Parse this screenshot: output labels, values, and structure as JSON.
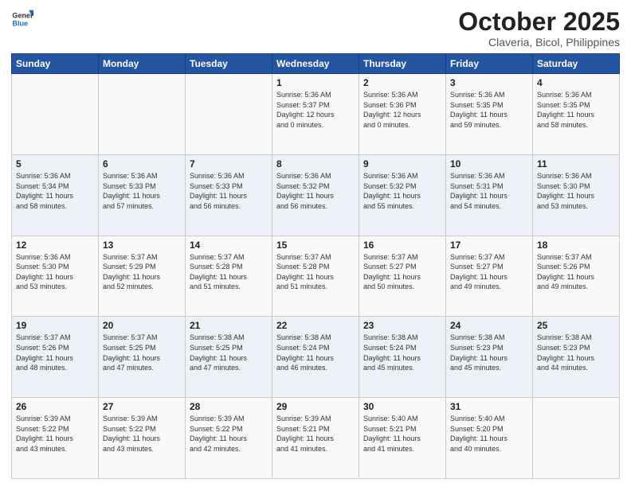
{
  "header": {
    "logo_general": "General",
    "logo_blue": "Blue",
    "month_title": "October 2025",
    "subtitle": "Claveria, Bicol, Philippines"
  },
  "weekdays": [
    "Sunday",
    "Monday",
    "Tuesday",
    "Wednesday",
    "Thursday",
    "Friday",
    "Saturday"
  ],
  "weeks": [
    [
      {
        "day": "",
        "info": ""
      },
      {
        "day": "",
        "info": ""
      },
      {
        "day": "",
        "info": ""
      },
      {
        "day": "1",
        "info": "Sunrise: 5:36 AM\nSunset: 5:37 PM\nDaylight: 12 hours\nand 0 minutes."
      },
      {
        "day": "2",
        "info": "Sunrise: 5:36 AM\nSunset: 5:36 PM\nDaylight: 12 hours\nand 0 minutes."
      },
      {
        "day": "3",
        "info": "Sunrise: 5:36 AM\nSunset: 5:35 PM\nDaylight: 11 hours\nand 59 minutes."
      },
      {
        "day": "4",
        "info": "Sunrise: 5:36 AM\nSunset: 5:35 PM\nDaylight: 11 hours\nand 58 minutes."
      }
    ],
    [
      {
        "day": "5",
        "info": "Sunrise: 5:36 AM\nSunset: 5:34 PM\nDaylight: 11 hours\nand 58 minutes."
      },
      {
        "day": "6",
        "info": "Sunrise: 5:36 AM\nSunset: 5:33 PM\nDaylight: 11 hours\nand 57 minutes."
      },
      {
        "day": "7",
        "info": "Sunrise: 5:36 AM\nSunset: 5:33 PM\nDaylight: 11 hours\nand 56 minutes."
      },
      {
        "day": "8",
        "info": "Sunrise: 5:36 AM\nSunset: 5:32 PM\nDaylight: 11 hours\nand 56 minutes."
      },
      {
        "day": "9",
        "info": "Sunrise: 5:36 AM\nSunset: 5:32 PM\nDaylight: 11 hours\nand 55 minutes."
      },
      {
        "day": "10",
        "info": "Sunrise: 5:36 AM\nSunset: 5:31 PM\nDaylight: 11 hours\nand 54 minutes."
      },
      {
        "day": "11",
        "info": "Sunrise: 5:36 AM\nSunset: 5:30 PM\nDaylight: 11 hours\nand 53 minutes."
      }
    ],
    [
      {
        "day": "12",
        "info": "Sunrise: 5:36 AM\nSunset: 5:30 PM\nDaylight: 11 hours\nand 53 minutes."
      },
      {
        "day": "13",
        "info": "Sunrise: 5:37 AM\nSunset: 5:29 PM\nDaylight: 11 hours\nand 52 minutes."
      },
      {
        "day": "14",
        "info": "Sunrise: 5:37 AM\nSunset: 5:28 PM\nDaylight: 11 hours\nand 51 minutes."
      },
      {
        "day": "15",
        "info": "Sunrise: 5:37 AM\nSunset: 5:28 PM\nDaylight: 11 hours\nand 51 minutes."
      },
      {
        "day": "16",
        "info": "Sunrise: 5:37 AM\nSunset: 5:27 PM\nDaylight: 11 hours\nand 50 minutes."
      },
      {
        "day": "17",
        "info": "Sunrise: 5:37 AM\nSunset: 5:27 PM\nDaylight: 11 hours\nand 49 minutes."
      },
      {
        "day": "18",
        "info": "Sunrise: 5:37 AM\nSunset: 5:26 PM\nDaylight: 11 hours\nand 49 minutes."
      }
    ],
    [
      {
        "day": "19",
        "info": "Sunrise: 5:37 AM\nSunset: 5:26 PM\nDaylight: 11 hours\nand 48 minutes."
      },
      {
        "day": "20",
        "info": "Sunrise: 5:37 AM\nSunset: 5:25 PM\nDaylight: 11 hours\nand 47 minutes."
      },
      {
        "day": "21",
        "info": "Sunrise: 5:38 AM\nSunset: 5:25 PM\nDaylight: 11 hours\nand 47 minutes."
      },
      {
        "day": "22",
        "info": "Sunrise: 5:38 AM\nSunset: 5:24 PM\nDaylight: 11 hours\nand 46 minutes."
      },
      {
        "day": "23",
        "info": "Sunrise: 5:38 AM\nSunset: 5:24 PM\nDaylight: 11 hours\nand 45 minutes."
      },
      {
        "day": "24",
        "info": "Sunrise: 5:38 AM\nSunset: 5:23 PM\nDaylight: 11 hours\nand 45 minutes."
      },
      {
        "day": "25",
        "info": "Sunrise: 5:38 AM\nSunset: 5:23 PM\nDaylight: 11 hours\nand 44 minutes."
      }
    ],
    [
      {
        "day": "26",
        "info": "Sunrise: 5:39 AM\nSunset: 5:22 PM\nDaylight: 11 hours\nand 43 minutes."
      },
      {
        "day": "27",
        "info": "Sunrise: 5:39 AM\nSunset: 5:22 PM\nDaylight: 11 hours\nand 43 minutes."
      },
      {
        "day": "28",
        "info": "Sunrise: 5:39 AM\nSunset: 5:22 PM\nDaylight: 11 hours\nand 42 minutes."
      },
      {
        "day": "29",
        "info": "Sunrise: 5:39 AM\nSunset: 5:21 PM\nDaylight: 11 hours\nand 41 minutes."
      },
      {
        "day": "30",
        "info": "Sunrise: 5:40 AM\nSunset: 5:21 PM\nDaylight: 11 hours\nand 41 minutes."
      },
      {
        "day": "31",
        "info": "Sunrise: 5:40 AM\nSunset: 5:20 PM\nDaylight: 11 hours\nand 40 minutes."
      },
      {
        "day": "",
        "info": ""
      }
    ]
  ]
}
